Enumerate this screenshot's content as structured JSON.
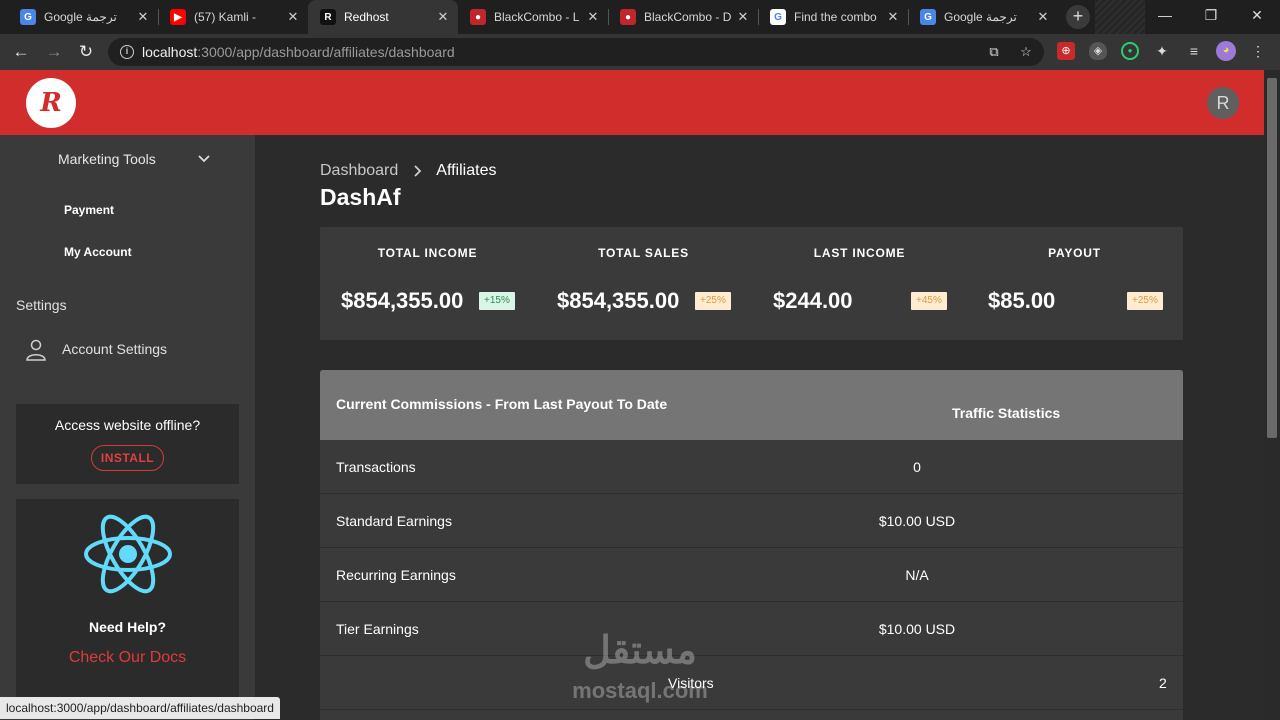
{
  "browser": {
    "tabs": [
      {
        "title": "Google ترجمة",
        "favicon": "google-translate-icon",
        "color": "#4a86e8",
        "glyph": "G"
      },
      {
        "title": "(57) Kamli -",
        "favicon": "youtube-icon",
        "color": "#ff0000",
        "glyph": "▶"
      },
      {
        "title": "Redhost",
        "favicon": "redhost-icon",
        "color": "#111111",
        "glyph": "R"
      },
      {
        "title": "BlackCombo - L",
        "favicon": "blackcombo-icon",
        "color": "#c0262c",
        "glyph": "●"
      },
      {
        "title": "BlackCombo - D",
        "favicon": "blackcombo-icon",
        "color": "#c0262c",
        "glyph": "●"
      },
      {
        "title": "Find the combo",
        "favicon": "google-icon",
        "color": "#ffffff",
        "glyph": "G"
      },
      {
        "title": "Google ترجمة",
        "favicon": "google-translate-icon",
        "color": "#4a86e8",
        "glyph": "G"
      }
    ],
    "active_tab": 2,
    "url_host": "localhost",
    "url_path": ":3000/app/dashboard/affiliates/dashboard",
    "status_url": "localhost:3000/app/dashboard/affiliates/dashboard"
  },
  "header": {
    "logo_letter": "R",
    "avatar_letter": "R",
    "brand_color": "#d22d2d"
  },
  "sidebar": {
    "marketing_tools": "Marketing Tools",
    "payment": "Payment",
    "my_account": "My Account",
    "settings_heading": "Settings",
    "account_settings": "Account Settings",
    "offline_text": "Access website offline?",
    "install_label": "INSTALL",
    "need_help": "Need Help?",
    "check_docs": "Check Our Docs"
  },
  "main": {
    "breadcrumb": [
      "Dashboard",
      "Affiliates"
    ],
    "title": "DashAf",
    "stats": [
      {
        "label": "TOTAL INCOME",
        "value": "$854,355.00",
        "badge": "+15%",
        "tone": "green"
      },
      {
        "label": "TOTAL SALES",
        "value": "$854,355.00",
        "badge": "+25%",
        "tone": "orange"
      },
      {
        "label": "LAST INCOME",
        "value": "$244.00",
        "badge": "+45%",
        "tone": "orange"
      },
      {
        "label": "PAYOUT",
        "value": "$85.00",
        "badge": "+25%",
        "tone": "orange"
      }
    ],
    "commissions_title": "Current Commissions - From Last Payout To Date",
    "traffic_title": "Traffic Statistics",
    "rows": [
      {
        "label": "Transactions",
        "value": "0"
      },
      {
        "label": "Standard Earnings",
        "value": "$10.00 USD"
      },
      {
        "label": "Recurring Earnings",
        "value": "N/A"
      },
      {
        "label": "Tier Earnings",
        "value": "$10.00 USD"
      }
    ],
    "visitors_label": "Visitors",
    "visitors_value": "2"
  },
  "watermark": {
    "arabic": "مستقل",
    "latin": "mostaql.com"
  }
}
